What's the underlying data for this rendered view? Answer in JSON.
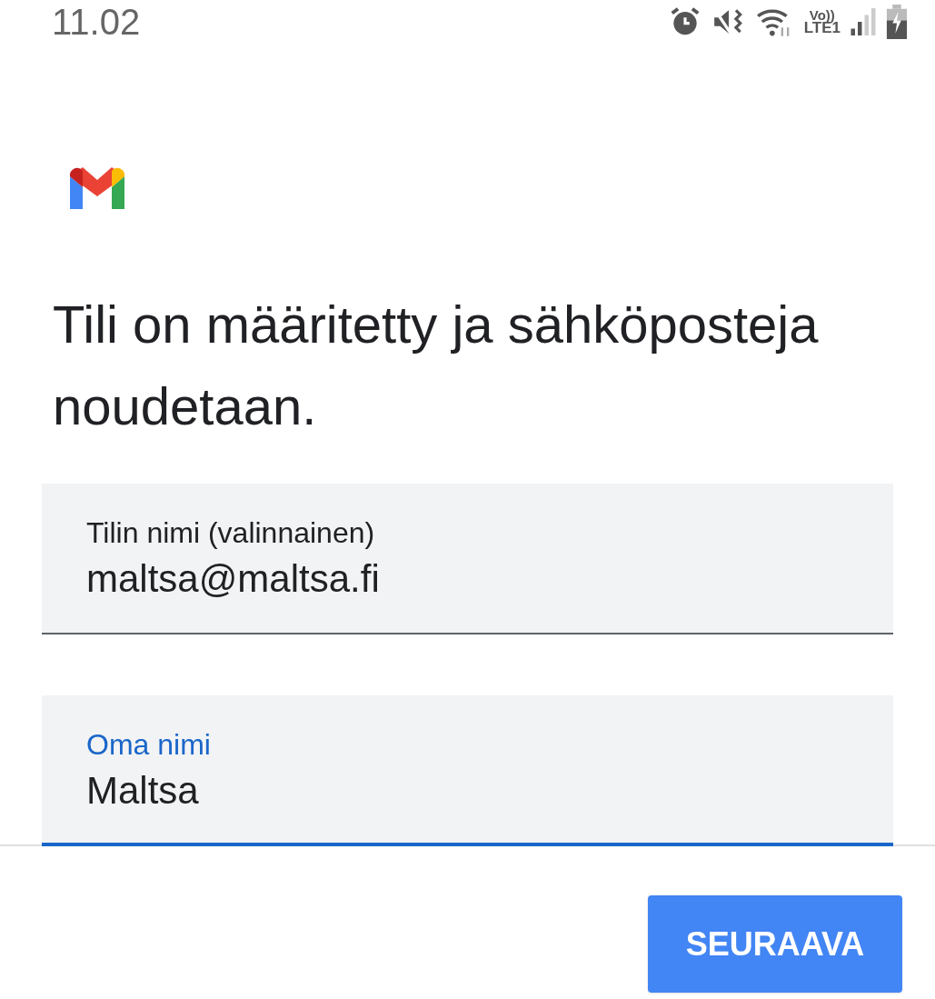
{
  "status_bar": {
    "time": "11.02",
    "network": "Vo))",
    "network_type": "LTE1"
  },
  "heading": "Tili on määritetty ja sähköposteja noudetaan.",
  "fields": [
    {
      "label": "Tilin nimi (valinnainen)",
      "value": "maltsa@maltsa.fi",
      "focused": false
    },
    {
      "label": "Oma nimi",
      "value": "Maltsa",
      "focused": true
    }
  ],
  "buttons": [
    {
      "label": "SEURAAVA"
    }
  ]
}
